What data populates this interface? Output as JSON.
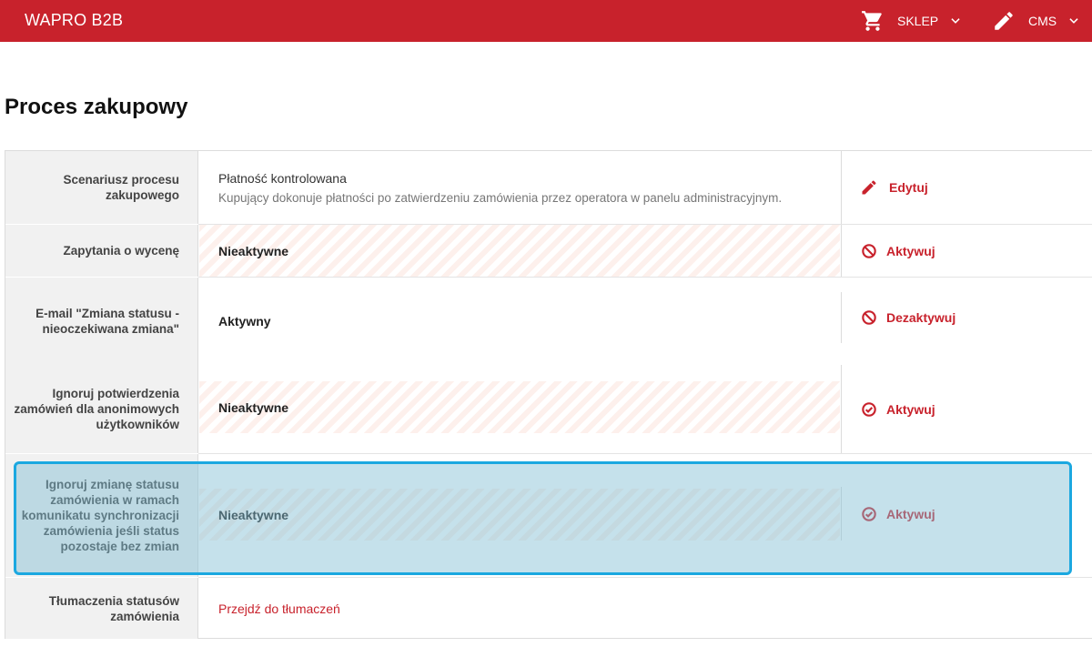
{
  "header": {
    "brand": "WAPRO B2B",
    "nav": [
      {
        "label": "SKLEP",
        "icon": "cart-icon"
      },
      {
        "label": "CMS",
        "icon": "pencil-icon"
      }
    ]
  },
  "page": {
    "title": "Proces zakupowy"
  },
  "rows": [
    {
      "label": "Scenariusz procesu zakupowego",
      "value_title": "Płatność kontrolowana",
      "value_desc": "Kupujący dokonuje płatności po zatwierdzeniu zamówienia przez operatora w panelu administracyjnym.",
      "action": "Edytuj",
      "action_icon": "pencil-icon"
    },
    {
      "label": "Zapytania o wycenę",
      "value": "Nieaktywne",
      "action": "Aktywuj",
      "action_icon": "block-icon"
    },
    {
      "label": "E-mail \"Zmiana statusu - nieoczekiwana zmiana\"",
      "value": "Aktywny",
      "action": "Dezaktywuj",
      "action_icon": "block-icon"
    },
    {
      "label": "Ignoruj potwierdzenia zamówień dla anonimowych użytkowników",
      "value": "Nieaktywne",
      "action": "Aktywuj",
      "action_icon": "check-circle-icon"
    },
    {
      "label": "Ignoruj zmianę statusu zamówienia w ramach komunikatu synchronizacji zamówienia jeśli status pozostaje bez zmian",
      "value": "Nieaktywne",
      "action": "Aktywuj",
      "action_icon": "check-circle-icon"
    },
    {
      "label": "Tłumaczenia statusów zamówienia",
      "link": "Przejdź do tłumaczeń"
    }
  ],
  "colors": {
    "brand": "#c8222c",
    "highlight_border": "#1ba8e0"
  }
}
